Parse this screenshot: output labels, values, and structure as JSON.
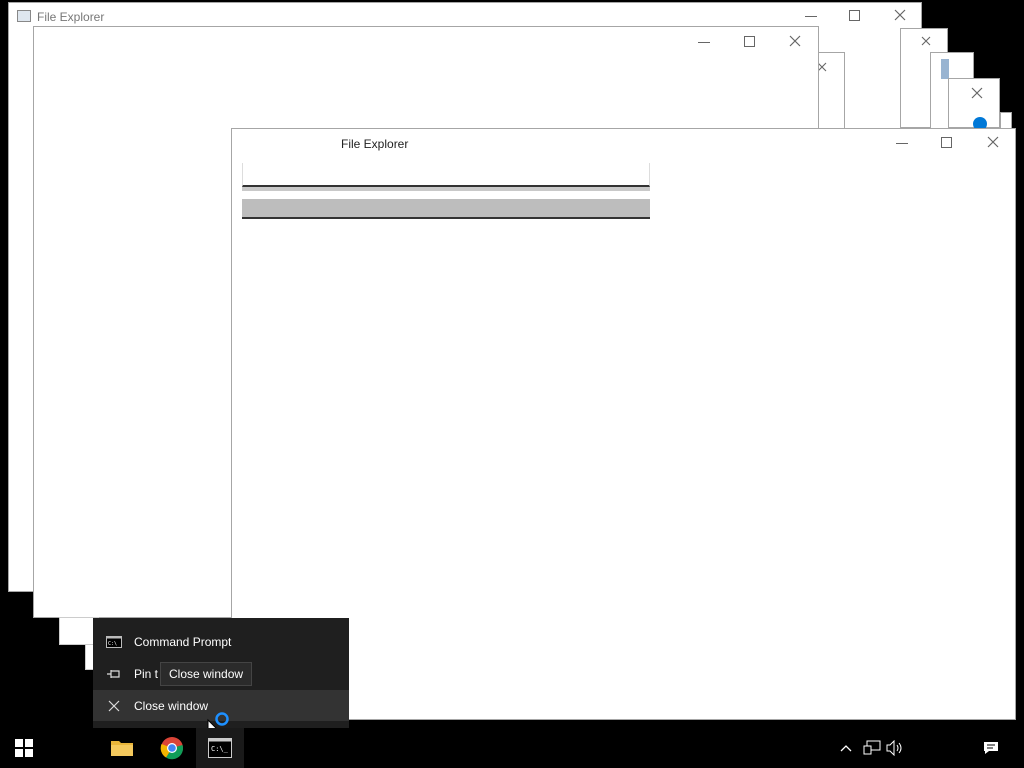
{
  "windows": {
    "back": {
      "title": "File Explorer",
      "subtitle": ""
    },
    "middle": {
      "title": ""
    },
    "front": {
      "title": "File Explorer"
    }
  },
  "jumplist": {
    "items": [
      {
        "label": "Command Prompt",
        "icon": "cmd-icon"
      },
      {
        "label": "Pin t",
        "icon": "pin-icon"
      },
      {
        "label": "Close window",
        "icon": "close-icon"
      }
    ]
  },
  "tooltip": {
    "text": "Close window"
  },
  "taskbar": {
    "apps": [
      "File Explorer",
      "Google Chrome",
      "Command Prompt"
    ],
    "tray": [
      "chevron-up-icon",
      "network-icon",
      "volume-icon",
      "action-center-icon"
    ]
  },
  "colors": {
    "taskbar": "#000000",
    "menu_bg": "#1f1f1f",
    "menu_hover": "#333333",
    "accent": "#0078d7"
  }
}
